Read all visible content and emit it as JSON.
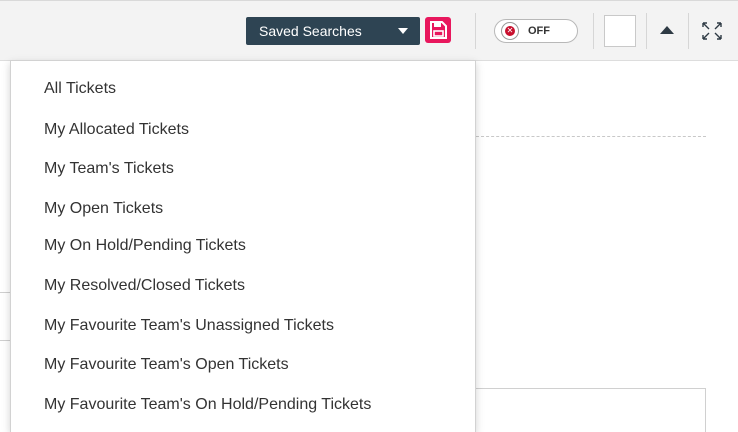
{
  "toolbar": {
    "saved_searches_label": "Saved Searches",
    "toggle_label": "OFF",
    "toggle_state": "off"
  },
  "icons": {
    "saved_searches_caret": "caret-down-icon",
    "save": "floppy-disk-icon",
    "toggle_off": "close-circle-icon",
    "collapse": "arrow-up-icon",
    "expand": "expand-icon"
  },
  "colors": {
    "saved_searches_bg": "#2e4453",
    "save_button": "#e8175d",
    "toggle_x": "#c8102e",
    "menu_text": "#333333"
  },
  "dropdown": {
    "items": [
      {
        "label": "All Tickets"
      },
      {
        "label": "My Allocated Tickets"
      },
      {
        "label": "My Team's Tickets"
      },
      {
        "label": "My Open Tickets"
      },
      {
        "label": "My On Hold/Pending Tickets"
      },
      {
        "label": "My Resolved/Closed Tickets"
      },
      {
        "label": "My Favourite Team's Unassigned Tickets"
      },
      {
        "label": "My Favourite Team's Open Tickets"
      },
      {
        "label": "My Favourite Team's On Hold/Pending Tickets"
      }
    ]
  }
}
